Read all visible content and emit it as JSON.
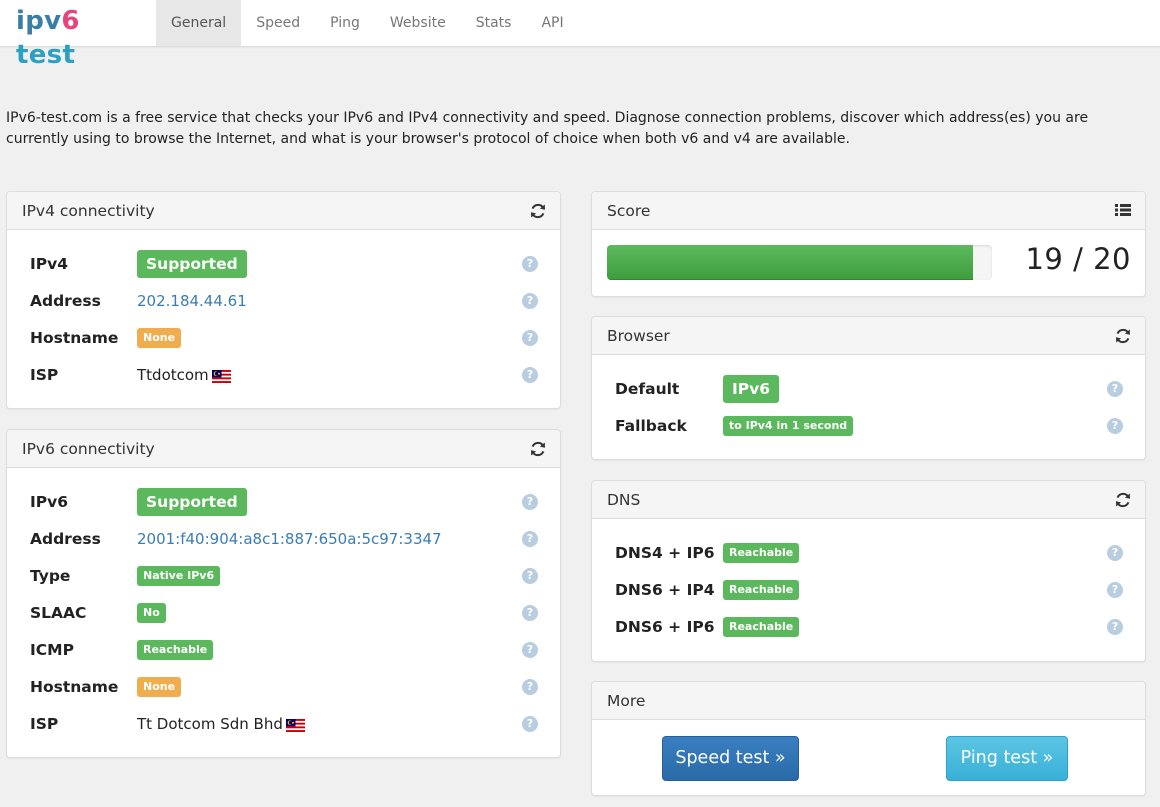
{
  "brand": {
    "ipv": "ipv",
    "six": "6",
    "test": " test"
  },
  "nav": {
    "tabs": [
      {
        "label": "General"
      },
      {
        "label": "Speed"
      },
      {
        "label": "Ping"
      },
      {
        "label": "Website"
      },
      {
        "label": "Stats"
      },
      {
        "label": "API"
      }
    ],
    "active": "General"
  },
  "intro": "IPv6-test.com is a free service that checks your IPv6 and IPv4 connectivity and speed. Diagnose connection problems, discover which address(es) you are currently using to browse the Internet, and what is your browser's protocol of choice when both v6 and v4 are available.",
  "ipv4": {
    "title": "IPv4 connectivity",
    "rows": [
      {
        "label": "IPv4",
        "value": "Supported"
      },
      {
        "label": "Address",
        "value": "202.184.44.61"
      },
      {
        "label": "Hostname",
        "value": "None"
      },
      {
        "label": "ISP",
        "value": "Ttdotcom"
      }
    ]
  },
  "ipv6": {
    "title": "IPv6 connectivity",
    "rows": [
      {
        "label": "IPv6",
        "value": "Supported"
      },
      {
        "label": "Address",
        "value": "2001:f40:904:a8c1:887:650a:5c97:3347"
      },
      {
        "label": "Type",
        "value": "Native IPv6"
      },
      {
        "label": "SLAAC",
        "value": "No"
      },
      {
        "label": "ICMP",
        "value": "Reachable"
      },
      {
        "label": "Hostname",
        "value": "None"
      },
      {
        "label": "ISP",
        "value": "Tt Dotcom Sdn Bhd"
      }
    ]
  },
  "score": {
    "title": "Score",
    "text": "19 / 20",
    "value": 19,
    "max": 20
  },
  "browser": {
    "title": "Browser",
    "rows": [
      {
        "label": "Default",
        "value": "IPv6"
      },
      {
        "label": "Fallback",
        "value": "to IPv4 in 1 second"
      }
    ]
  },
  "dns": {
    "title": "DNS",
    "rows": [
      {
        "label": "DNS4 + IP6",
        "value": "Reachable"
      },
      {
        "label": "DNS6 + IP4",
        "value": "Reachable"
      },
      {
        "label": "DNS6 + IP6",
        "value": "Reachable"
      }
    ]
  },
  "more": {
    "title": "More",
    "speed_button": "Speed test »",
    "ping_button": "Ping test »"
  },
  "help_glyph": "?",
  "colors": {
    "success": "#5cb85c",
    "warning": "#f0ad4e",
    "link": "#3a7db5",
    "primary": "#2a6aa8",
    "info": "#39b0d8"
  },
  "icons": {
    "refresh": "refresh-icon",
    "list": "list-icon",
    "help": "help-icon",
    "flag": "malaysia-flag-icon"
  }
}
